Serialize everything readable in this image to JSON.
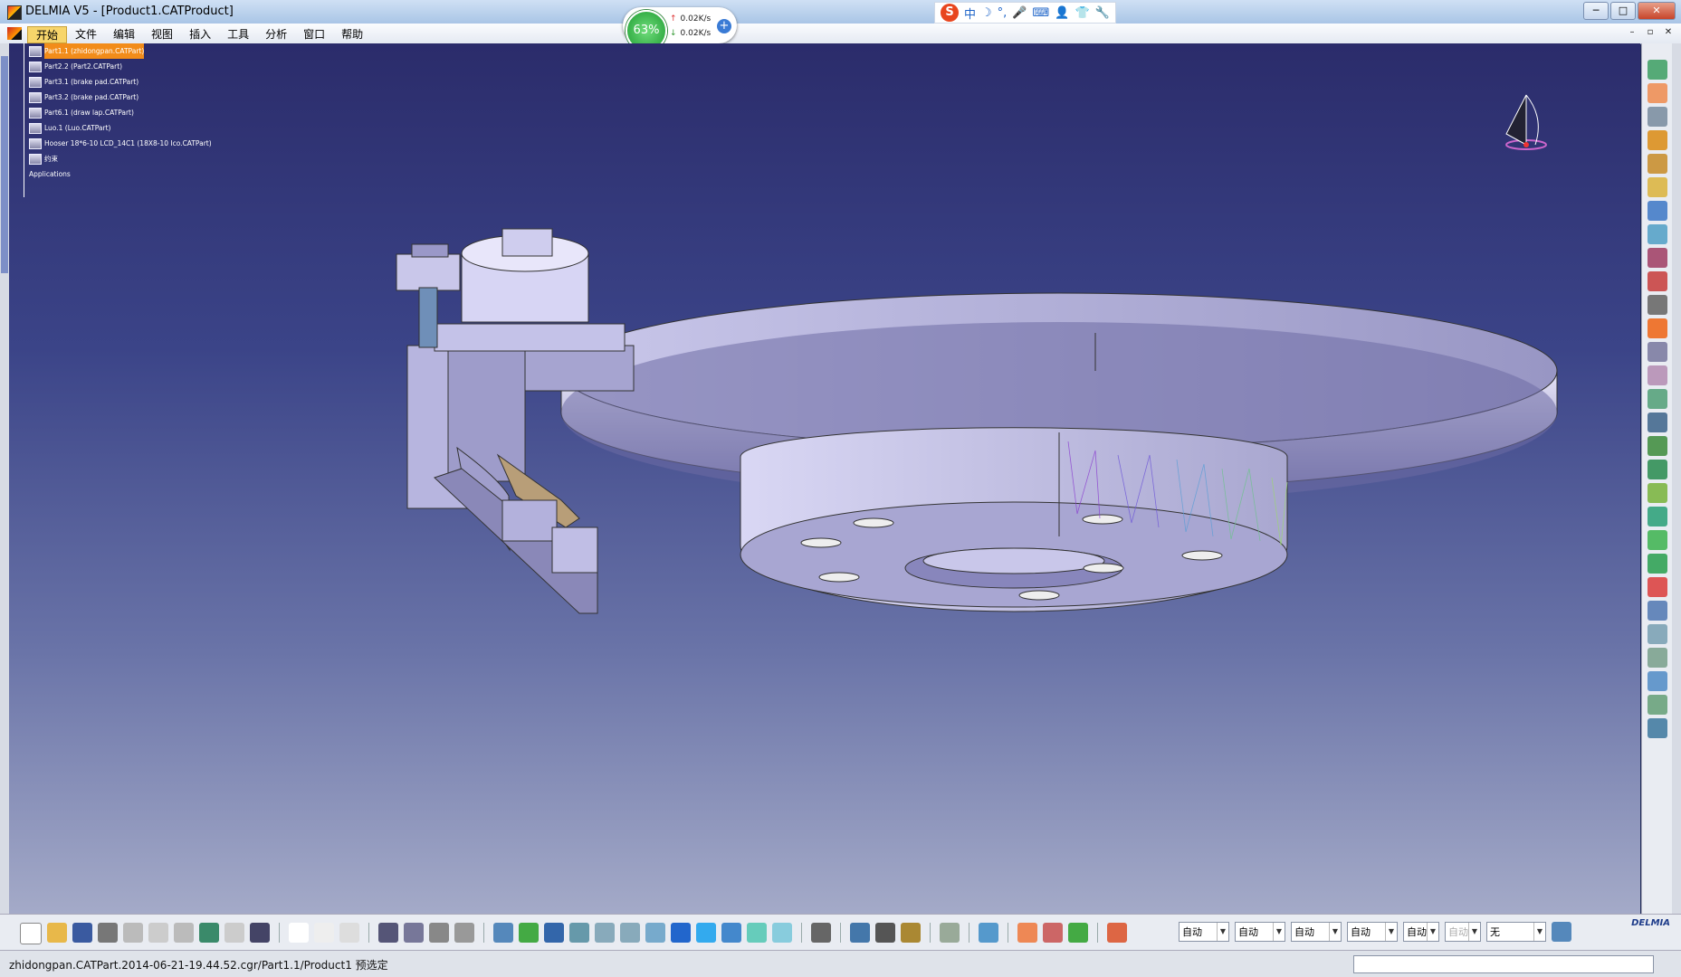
{
  "window": {
    "title": "DELMIA V5 - [Product1.CATProduct]",
    "controls": [
      "─",
      "□",
      "✕"
    ]
  },
  "menu": {
    "items": [
      "开始",
      "文件",
      "编辑",
      "视图",
      "插入",
      "工具",
      "分析",
      "窗口",
      "帮助"
    ],
    "doc_controls": [
      "–",
      "▫",
      "✕"
    ]
  },
  "net_widget": {
    "percent": "63%",
    "upload": "0.02K/s",
    "download": "0.02K/s"
  },
  "ime": {
    "logo": "S",
    "items": [
      "中",
      "☽",
      "°,",
      "🎤",
      "⌨",
      "👤",
      "👕",
      "🔧"
    ]
  },
  "tree": {
    "items": [
      "Part1.1 (zhidongpan.CATPart)",
      "Part2.2 (Part2.CATPart)",
      "Part3.1 (brake pad.CATPart)",
      "Part3.2 (brake pad.CATPart)",
      "Part6.1 (draw lap.CATPart)",
      "Luo.1 (Luo.CATPart)",
      "Hooser 18*6-10 LCD_14C1 (18X8-10 Ico.CATPart)",
      "约束",
      "Applications"
    ]
  },
  "bottom_toolbar": {
    "selects": [
      {
        "value": "自动",
        "disabled": false
      },
      {
        "value": "自动",
        "disabled": false
      },
      {
        "value": "自动",
        "disabled": false
      },
      {
        "value": "自动",
        "disabled": false
      },
      {
        "value": "自动",
        "disabled": false
      },
      {
        "value": "自动",
        "disabled": true
      },
      {
        "value": "无",
        "disabled": false
      }
    ],
    "brand": "DELMIA"
  },
  "status": {
    "text": "zhidongpan.CATPart.2014-06-21-19.44.52.cgr/Part1.1/Product1 预选定"
  },
  "colors": {
    "viewport_top": "#2b2c6b",
    "viewport_bottom": "#a4aac8",
    "selection": "#f28c1a",
    "accent": "#3a7bd5"
  }
}
